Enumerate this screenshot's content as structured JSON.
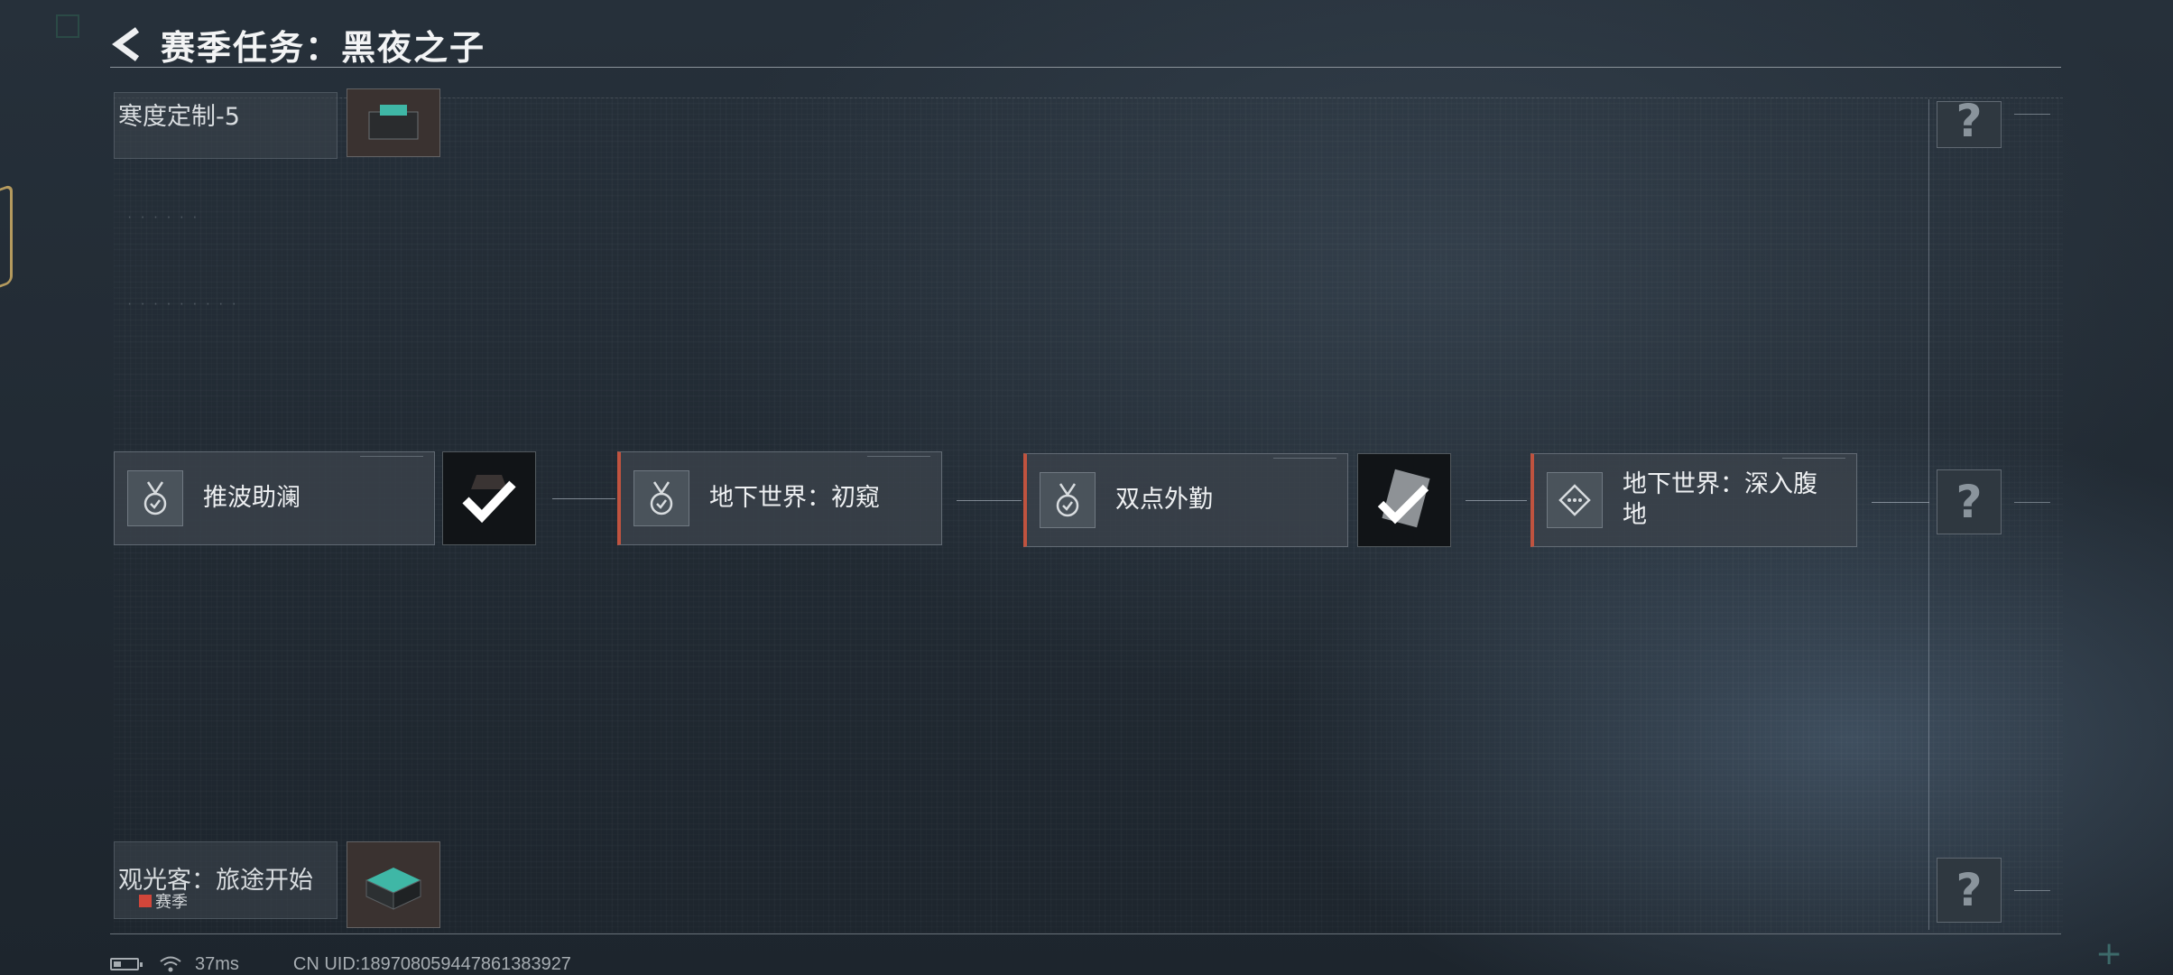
{
  "header": {
    "title": "赛季任务：黑夜之子"
  },
  "side_cards": [
    {
      "label": "寒度定制-5",
      "reward_icon": "chest-icon"
    },
    {
      "label": "观光客：旅途开始",
      "tag": "赛季",
      "reward_icon": "chest-icon"
    }
  ],
  "nodes": [
    {
      "label": "推波助澜",
      "icon": "medal-check-icon",
      "active": false,
      "reward": "check-reward"
    },
    {
      "label": "地下世界：初窥",
      "icon": "medal-check-icon",
      "active": true
    },
    {
      "label": "双点外勤",
      "icon": "medal-check-icon",
      "active": true,
      "reward": "check-card-reward"
    },
    {
      "label": "地下世界：深入腹地",
      "icon": "diamond-dots-icon",
      "active": true
    }
  ],
  "locked_nodes": [
    "?",
    "?",
    "?"
  ],
  "status": {
    "ping": "37ms",
    "uid": "CN UID:1897080594478613839​27"
  },
  "colors": {
    "accent": "#c0533f",
    "panel": "#3a424a",
    "background": "#222b34"
  }
}
